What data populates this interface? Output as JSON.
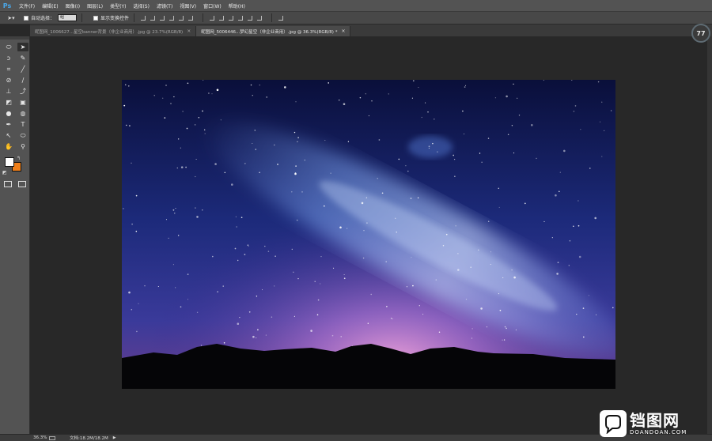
{
  "app": {
    "logo": "Ps"
  },
  "menu": [
    "文件(F)",
    "编辑(E)",
    "图像(I)",
    "图层(L)",
    "类型(Y)",
    "选择(S)",
    "滤镜(T)",
    "视图(V)",
    "窗口(W)",
    "帮助(H)"
  ],
  "options": {
    "move_tool_icon": "move-icon",
    "auto_select_label": "自动选择：",
    "auto_select_value": "组",
    "show_transform_label": "显示变换控件"
  },
  "tabs": [
    {
      "label": "昵图网_1006627...星空banner背景（非企业商用）.jpg @ 23.7%(RGB/8)",
      "active": false
    },
    {
      "label": "昵图网_5006446...梦幻星空（非企业商用）.jpg @ 36.3%(RGB/8) *",
      "active": true
    }
  ],
  "navigator_zoom": "77",
  "tools": [
    "marquee-icon",
    "move-icon",
    "lasso-icon",
    "quick-select-icon",
    "crop-icon",
    "eyedropper-icon",
    "spot-heal-icon",
    "brush-icon",
    "stamp-icon",
    "history-brush-icon",
    "eraser-icon",
    "gradient-icon",
    "blur-icon",
    "dodge-icon",
    "pen-icon",
    "type-icon",
    "path-select-icon",
    "shape-icon",
    "hand-icon",
    "zoom-icon"
  ],
  "colors": {
    "foreground": "#ffffff",
    "background": "#ef7f1a"
  },
  "status": {
    "zoom": "36.3%",
    "doc": "文档:18.2M/18.2M"
  },
  "watermark": {
    "title": "铛图网",
    "subtitle": "DOANDOAN.COM"
  }
}
